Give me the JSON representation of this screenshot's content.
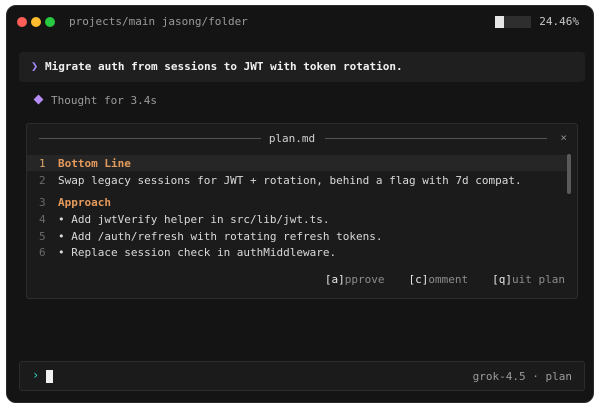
{
  "titlebar": {
    "path": "projects/main jasong/folder",
    "usage_percent": 24.46,
    "usage_label": "24.46%"
  },
  "prompt": {
    "chevron": "❯",
    "text": "Migrate auth from sessions to JWT with token rotation."
  },
  "thought": {
    "text": "Thought for 3.4s"
  },
  "panel": {
    "title": "plan.md",
    "close": "×",
    "lines": [
      {
        "num": "1",
        "text": "Bottom Line",
        "heading": true
      },
      {
        "num": "2",
        "text": "Swap legacy sessions for JWT + rotation, behind a flag with 7d compat."
      },
      {
        "num": "3",
        "text": "Approach",
        "heading": true
      },
      {
        "num": "4",
        "text": "• Add jwtVerify helper in src/lib/jwt.ts."
      },
      {
        "num": "5",
        "text": "• Add /auth/refresh with rotating refresh tokens."
      },
      {
        "num": "6",
        "text": "• Replace session check in authMiddleware."
      }
    ],
    "actions": [
      {
        "key": "[a]",
        "label": "pprove"
      },
      {
        "key": "[c]",
        "label": "omment"
      },
      {
        "key": "[q]",
        "label": "uit plan"
      }
    ]
  },
  "input": {
    "chevron": "›",
    "model_label": "grok-4.5 · plan"
  },
  "colors": {
    "accent_purple": "#a78bfa",
    "accent_teal": "#2dd4bf",
    "heading_orange": "#e59a5b"
  }
}
